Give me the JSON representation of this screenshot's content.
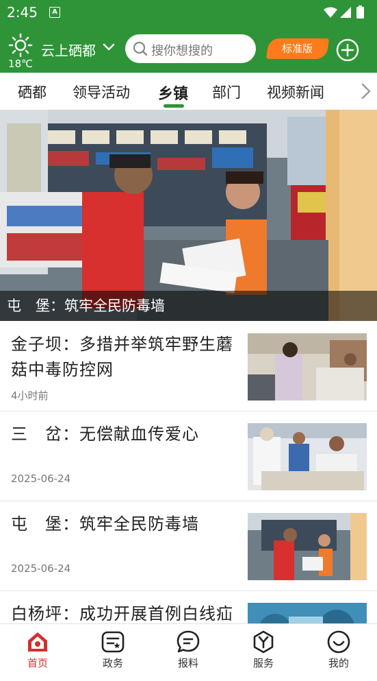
{
  "status_bar": {
    "time": "2:45",
    "notification_icon": "A"
  },
  "header": {
    "weather_temp": "18℃",
    "city": "云上硒都",
    "search_placeholder": "搜你想搜的",
    "edition_label": "标准版"
  },
  "tabs": [
    "硒都",
    "领导活动",
    "乡镇",
    "部门",
    "视频新闻"
  ],
  "active_tab": "乡镇",
  "hero": {
    "caption": "屯　堡：筑牢全民防毒墙"
  },
  "news": [
    {
      "title": "金子坝：多措并举筑牢野生蘑菇中毒防控网",
      "meta": "4小时前"
    },
    {
      "title": "三　岔：无偿献血传爱心",
      "meta": "2025-06-24"
    },
    {
      "title": "屯　堡：筑牢全民防毒墙",
      "meta": "2025-06-24"
    },
    {
      "title": "白杨坪：成功开展首例白线疝",
      "meta": ""
    }
  ],
  "bottom_nav": [
    {
      "label": "首页",
      "icon": "home-icon",
      "active": true
    },
    {
      "label": "政务",
      "icon": "government-icon",
      "active": false
    },
    {
      "label": "报料",
      "icon": "report-chat-icon",
      "active": false
    },
    {
      "label": "服务",
      "icon": "service-icon",
      "active": false
    },
    {
      "label": "我的",
      "icon": "profile-smile-icon",
      "active": false
    }
  ],
  "colors": {
    "brand_green": "#2e9437",
    "accent_orange": "#ff7a1a",
    "active_red": "#d32f2f"
  }
}
